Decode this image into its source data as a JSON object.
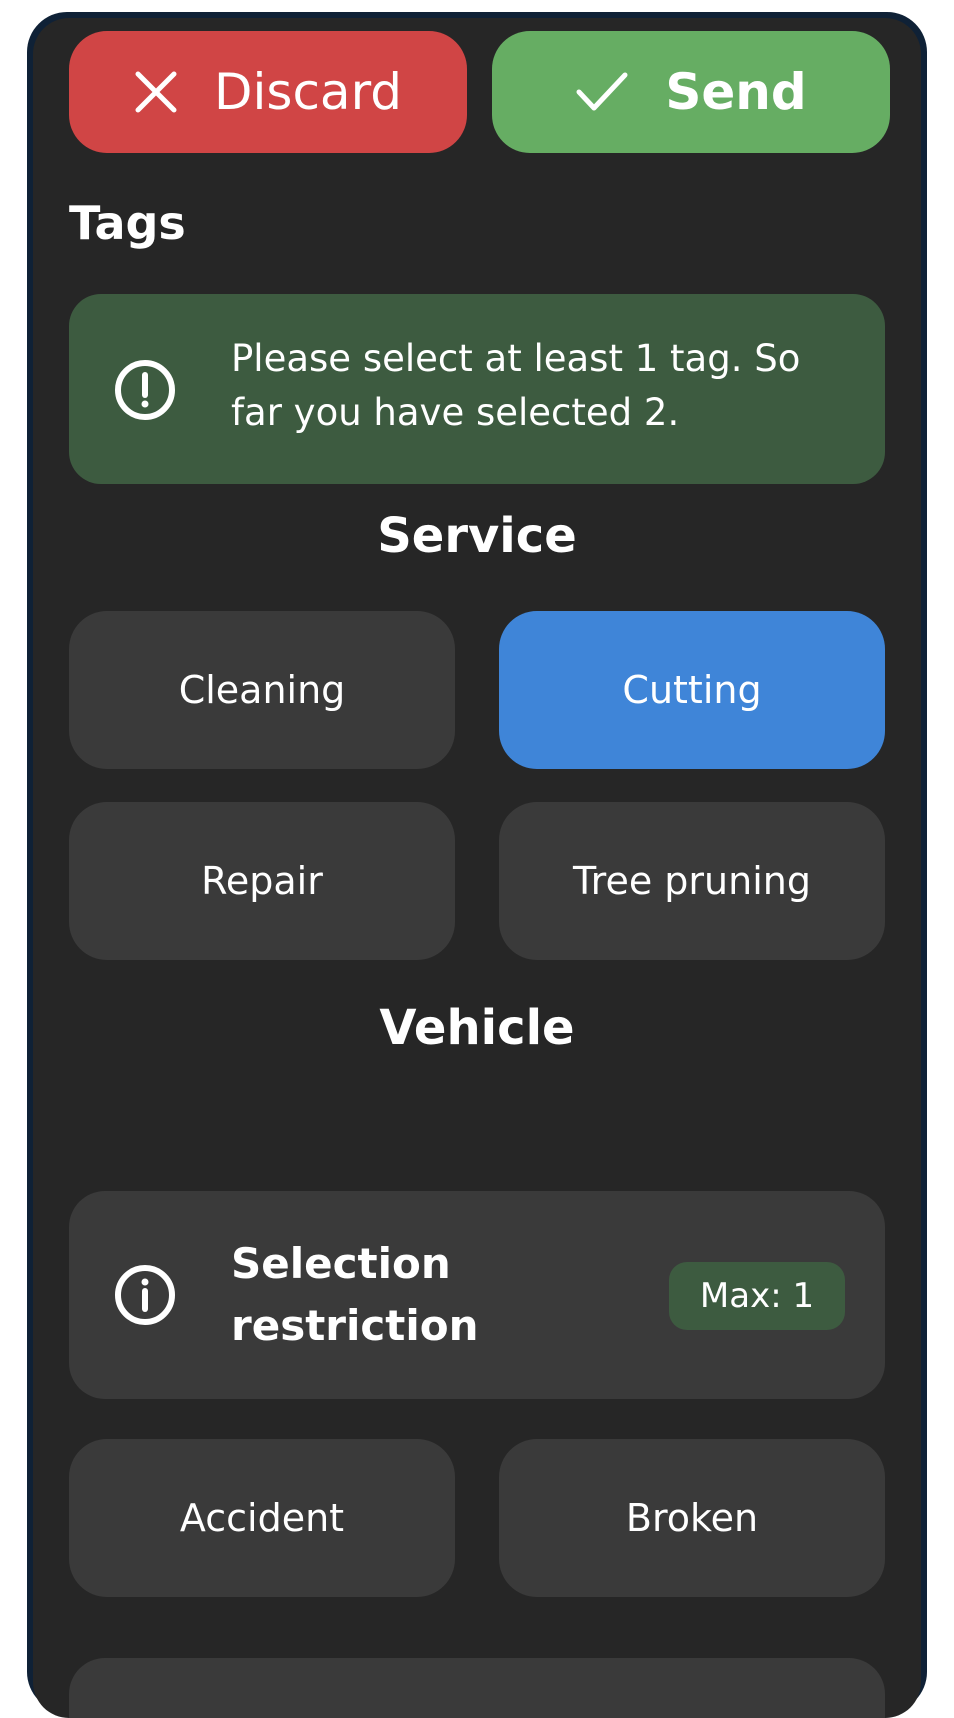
{
  "actions": {
    "discard_label": "Discard",
    "send_label": "Send"
  },
  "tags": {
    "title": "Tags",
    "notice": "Please select at least 1 tag. So far you have selected 2."
  },
  "groups": [
    {
      "title": "Service",
      "items": [
        {
          "label": "Cleaning",
          "selected": false
        },
        {
          "label": "Cutting",
          "selected": true
        },
        {
          "label": "Repair",
          "selected": false
        },
        {
          "label": "Tree pruning",
          "selected": false
        }
      ]
    },
    {
      "title": "Vehicle",
      "restriction": {
        "title": "Selection restriction",
        "badge": "Max: 1"
      },
      "items": [
        {
          "label": "Accident",
          "selected": false
        },
        {
          "label": "Broken",
          "selected": false
        }
      ]
    }
  ],
  "colors": {
    "discard": "#d04545",
    "send": "#66ad63",
    "selected": "#3f85d8",
    "notice": "#3d5b40",
    "tile": "#3a3a3a",
    "background": "#262626"
  },
  "icons": {
    "discard": "close-icon",
    "send": "check-icon",
    "notice": "alert-circle-icon",
    "restriction": "info-circle-icon"
  }
}
